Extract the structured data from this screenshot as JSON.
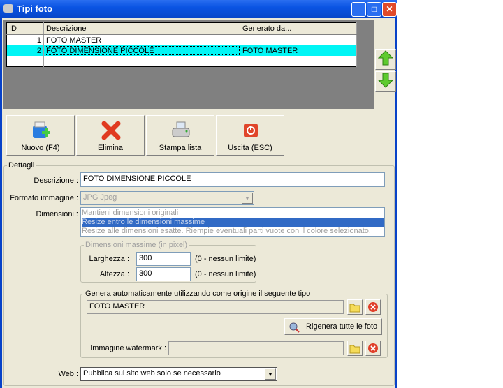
{
  "window": {
    "title": "Tipi foto",
    "min": "_",
    "max": "□",
    "close": "✕"
  },
  "grid": {
    "columns": [
      "ID",
      "Descrizione",
      "Generato da..."
    ],
    "rows": [
      {
        "id": "1",
        "descrizione": "FOTO MASTER",
        "generato": ""
      },
      {
        "id": "2",
        "descrizione": "FOTO DIMENSIONE PICCOLE",
        "generato": "FOTO MASTER"
      }
    ]
  },
  "toolbar": {
    "nuovo": "Nuovo (F4)",
    "elimina": "Elimina",
    "stampa": "Stampa lista",
    "uscita": "Uscita (ESC)"
  },
  "details": {
    "legend": "Dettagli",
    "descrizione_label": "Descrizione :",
    "descrizione_value": "FOTO DIMENSIONE PICCOLE",
    "formato_label": "Formato immagine :",
    "formato_value": "JPG Jpeg",
    "dimensioni_label": "Dimensioni :",
    "dimensioni_options": [
      "Mantieni dimensioni originali",
      "Resize entro le dimensioni massime",
      "Resize alle dimensioni esatte. Riempie eventuali parti vuote con il colore selezionato."
    ],
    "max_legend": "Dimensioni massime (in pixel)",
    "larghezza_label": "Larghezza :",
    "larghezza_value": "300",
    "altezza_label": "Altezza :",
    "altezza_value": "300",
    "limit_hint": "(0 - nessun limite)",
    "genera_legend": "Genera automaticamente utilizzando come origine il seguente tipo",
    "genera_value": "FOTO MASTER",
    "rigenera": "Rigenera tutte le foto",
    "watermark_label": "Immagine watermark :",
    "watermark_value": "",
    "web_label": "Web :",
    "web_value": "Pubblica sul sito web solo se necessario"
  }
}
